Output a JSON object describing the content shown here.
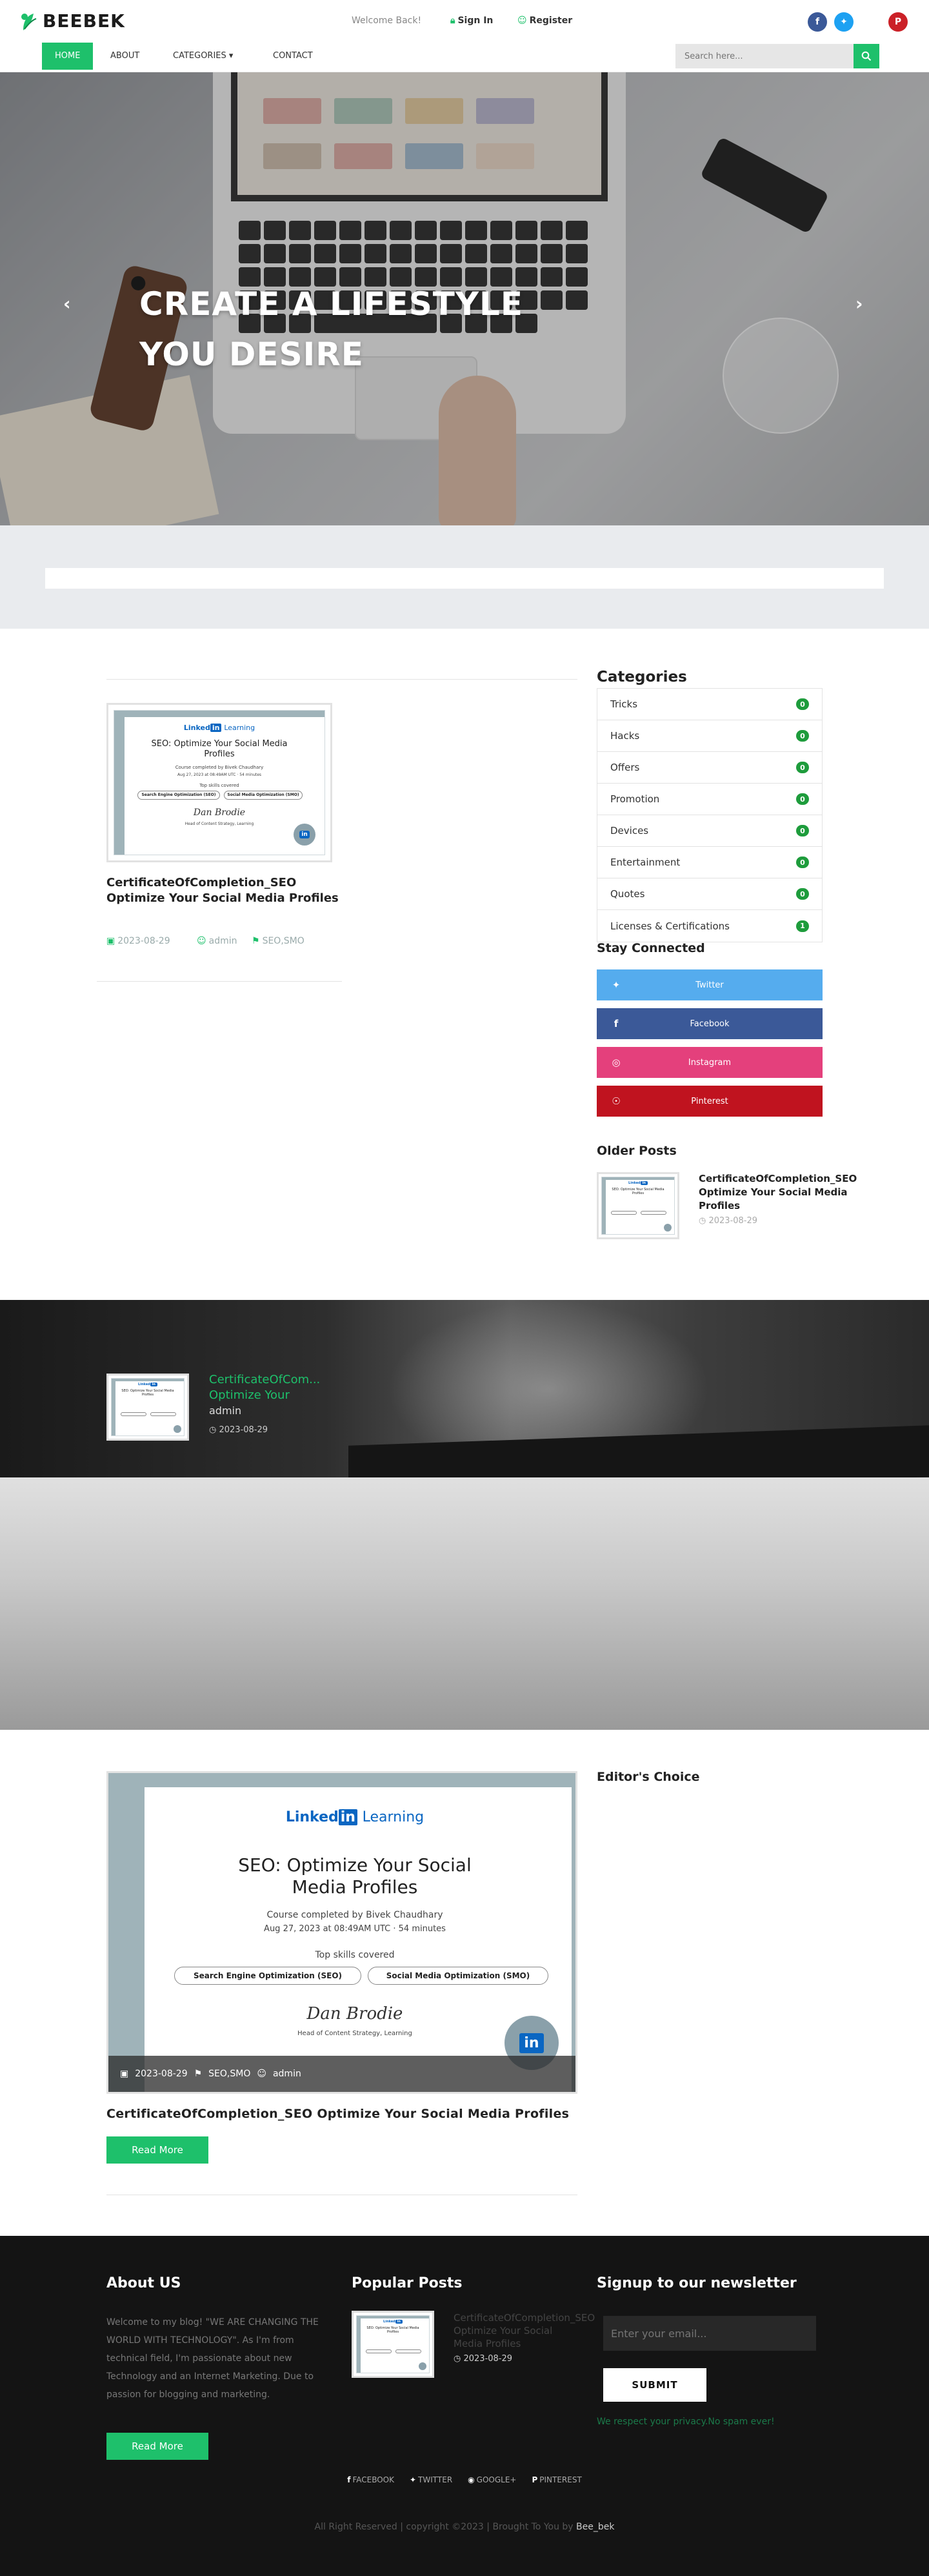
{
  "brand": {
    "name": "BEEBEK",
    "accent": "#1ec06b"
  },
  "topbar": {
    "welcome": "Welcome Back!",
    "signin": "Sign In",
    "register": "Register",
    "social": [
      {
        "name": "facebook",
        "glyph": "f",
        "color": "#3b5998"
      },
      {
        "name": "twitter",
        "glyph": "t",
        "color": "#1da1f2"
      },
      {
        "name": "pinterest",
        "glyph": "P",
        "color": "#cb2027"
      }
    ]
  },
  "nav": {
    "items": [
      "HOME",
      "ABOUT",
      "CATEGORIES ▾",
      "CONTACT"
    ],
    "search_placeholder": "Search here..."
  },
  "hero": {
    "title": "CREATE A LIFESTYLE\nYOU DESIRE",
    "prev": "‹",
    "next": "›"
  },
  "post": {
    "title": "CertificateOfCompletion_SEO Optimize Your Social Media Profiles",
    "date": "2023-08-29",
    "author": "admin",
    "tags": "SEO,SMO"
  },
  "certificate": {
    "logo_left": "Linked",
    "logo_in": "in",
    "logo_right": "Learning",
    "title": "SEO: Optimize Your Social Media Profiles",
    "completed_by": "Course completed by Bivek Chaudhary",
    "date_line": "Aug 27, 2023 at 08:49AM UTC · 54 minutes",
    "skills_heading": "Top skills covered",
    "skill1": "Search Engine Optimization (SEO)",
    "skill2": "Social Media Optimization (SMO)",
    "signer": "Head of Content Strategy, Learning"
  },
  "sidebar": {
    "categories_heading": "Categories",
    "categories": [
      {
        "name": "Tricks",
        "count": "0"
      },
      {
        "name": "Hacks",
        "count": "0"
      },
      {
        "name": "Offers",
        "count": "0"
      },
      {
        "name": "Promotion",
        "count": "0"
      },
      {
        "name": "Devices",
        "count": "0"
      },
      {
        "name": "Entertainment",
        "count": "0"
      },
      {
        "name": "Quotes",
        "count": "0"
      },
      {
        "name": "Licenses & Certifications",
        "count": "1"
      }
    ],
    "stay_heading": "Stay Connected",
    "social_buttons": [
      {
        "label": "Twitter",
        "color": "#55acee",
        "icon": "twitter-icon"
      },
      {
        "label": "Facebook",
        "color": "#3b5998",
        "icon": "facebook-icon"
      },
      {
        "label": "Instagram",
        "color": "#e4407c",
        "icon": "instagram-icon"
      },
      {
        "label": "Pinterest",
        "color": "#c0131f",
        "icon": "pinterest-icon"
      }
    ],
    "older_heading": "Older Posts",
    "older_title": "CertificateOfCompletion_SEO Optimize Your Social Media Profiles",
    "older_date": "2023-08-29"
  },
  "dark_section": {
    "title": "CertificateOfCom... Optimize Your",
    "author": "admin",
    "date": "2023-08-29"
  },
  "feature": {
    "date": "2023-08-29",
    "tags": "SEO,SMO",
    "author": "admin",
    "title": "CertificateOfCompletion_SEO Optimize Your Social Media Profiles",
    "read_more": "Read More",
    "editors_heading": "Editor's Choice"
  },
  "footer": {
    "about_heading": "About US",
    "about_text": "Welcome to my blog! \"WE ARE CHANGING THE WORLD WITH TECHNOLOGY\". As I'm from technical field, I'm passionate about new Technology and an Internet Marketing. Due to passion for blogging and marketing.",
    "read_more": "Read More",
    "popular_heading": "Popular Posts",
    "popular_title": "CertificateOfCompletion_SEO Optimize Your Social Media Profiles",
    "popular_date": "2023-08-29",
    "newsletter_heading": "Signup to our newsletter",
    "email_placeholder": "Enter your email...",
    "submit": "SUBMIT",
    "privacy": "We respect your privacy.No spam ever!",
    "links": [
      "FACEBOOK",
      "TWITTER",
      "GOOGLE+",
      "PINTEREST"
    ],
    "copyright": "All Right Reserved | copyright ©2023 | Brought To You by",
    "copyright_brand": "Bee_bek"
  }
}
